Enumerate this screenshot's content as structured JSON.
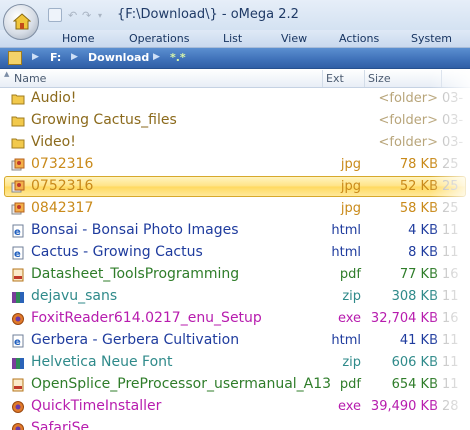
{
  "window": {
    "title": "{F:\\Download\\} - oMega 2.2"
  },
  "ribbon": {
    "tabs": [
      "Home",
      "Operations",
      "List",
      "View",
      "Actions",
      "System"
    ]
  },
  "path": {
    "drive": "F:",
    "folder": "Download",
    "filter": "*.*"
  },
  "columns": {
    "name": "Name",
    "ext": "Ext",
    "size": "Size"
  },
  "colors": {
    "folder": "#8b6a1c",
    "image": "#c98a1a",
    "html": "#1f3c9e",
    "pdf": "#2f7d2a",
    "zip": "#2f8a8a",
    "exe": "#b71cae",
    "selected_bg": "#ffe283"
  },
  "files": [
    {
      "name": "Audio!",
      "ext": "",
      "size": "<folder>",
      "date": "03-",
      "kind": "folder"
    },
    {
      "name": "Growing Cactus_files",
      "ext": "",
      "size": "<folder>",
      "date": "03-",
      "kind": "folder"
    },
    {
      "name": "Video!",
      "ext": "",
      "size": "<folder>",
      "date": "03-",
      "kind": "folder"
    },
    {
      "name": "0732316",
      "ext": "jpg",
      "size": "78 KB",
      "date": "25",
      "kind": "image"
    },
    {
      "name": "0752316",
      "ext": "jpg",
      "size": "52 KB",
      "date": "25",
      "kind": "image",
      "selected": true
    },
    {
      "name": "0842317",
      "ext": "jpg",
      "size": "58 KB",
      "date": "25",
      "kind": "image"
    },
    {
      "name": "Bonsai - Bonsai Photo Images",
      "ext": "html",
      "size": "4 KB",
      "date": "11",
      "kind": "html"
    },
    {
      "name": "Cactus - Growing Cactus",
      "ext": "html",
      "size": "8 KB",
      "date": "11",
      "kind": "html"
    },
    {
      "name": "Datasheet_ToolsProgramming",
      "ext": "pdf",
      "size": "77 KB",
      "date": "16",
      "kind": "pdf"
    },
    {
      "name": "dejavu_sans",
      "ext": "zip",
      "size": "308 KB",
      "date": "11",
      "kind": "zip"
    },
    {
      "name": "FoxitReader614.0217_enu_Setup",
      "ext": "exe",
      "size": "32,704 KB",
      "date": "16",
      "kind": "exe"
    },
    {
      "name": "Gerbera - Gerbera Cultivation",
      "ext": "html",
      "size": "41 KB",
      "date": "11",
      "kind": "html"
    },
    {
      "name": "Helvetica Neue Font",
      "ext": "zip",
      "size": "606 KB",
      "date": "11",
      "kind": "zip"
    },
    {
      "name": "OpenSplice_PreProcessor_usermanual_A13",
      "ext": "pdf",
      "size": "654 KB",
      "date": "11",
      "kind": "pdf"
    },
    {
      "name": "QuickTimeInstaller",
      "ext": "exe",
      "size": "39,490 KB",
      "date": "28",
      "kind": "exe"
    },
    {
      "name": "SafariSe",
      "ext": "",
      "size": "",
      "date": "",
      "kind": "exe",
      "partial": true
    }
  ]
}
